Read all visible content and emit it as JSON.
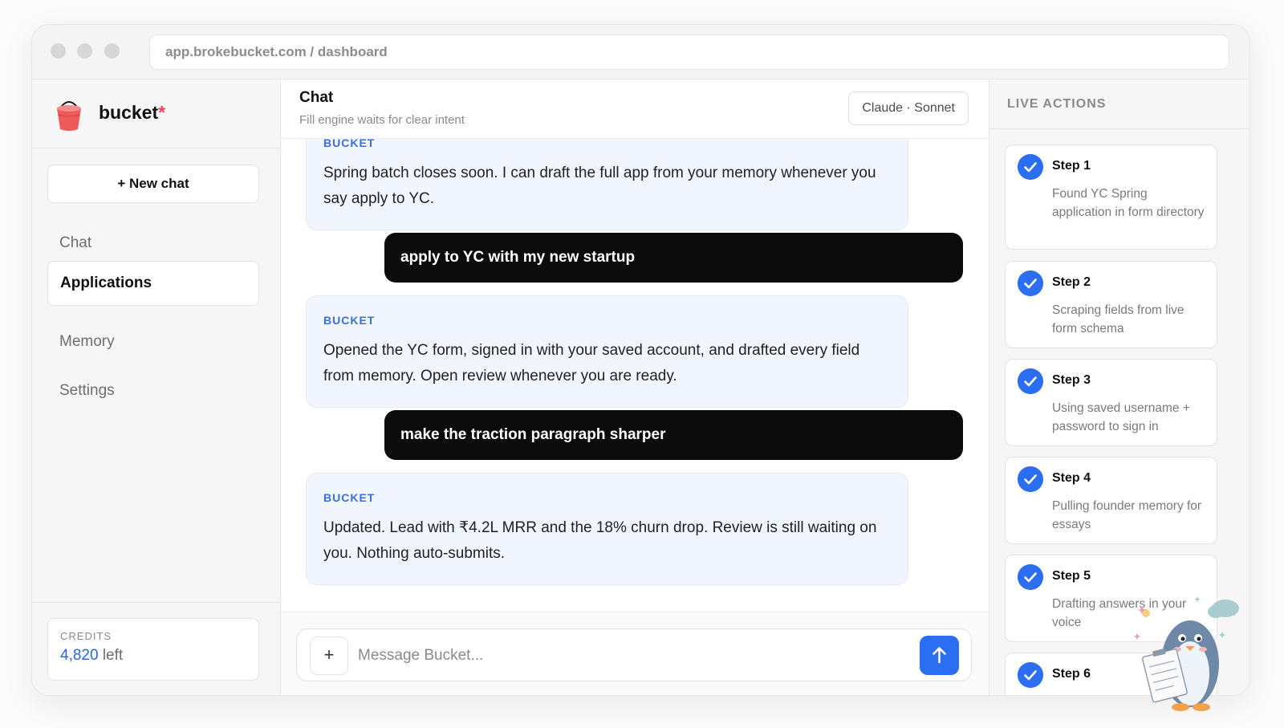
{
  "browser": {
    "url": "app.brokebucket.com / dashboard"
  },
  "brand": {
    "name": "bucket",
    "mark": "*"
  },
  "sidebar": {
    "new_chat_label": "+ New chat",
    "items": [
      {
        "label": "Chat",
        "active": false
      },
      {
        "label": "Applications",
        "active": true
      },
      {
        "label": "Memory",
        "active": false
      },
      {
        "label": "Settings",
        "active": false
      }
    ],
    "credits": {
      "label": "CREDITS",
      "value": "4,820",
      "suffix": "left"
    }
  },
  "chat": {
    "title": "Chat",
    "subtitle": "Fill engine waits for clear intent",
    "model": "Claude · Sonnet",
    "messages": [
      {
        "role": "bot",
        "label": "BUCKET",
        "text": "Spring batch closes soon. I can draft the full app from your memory whenever you say apply to YC."
      },
      {
        "role": "user",
        "text": "apply to YC with my new startup"
      },
      {
        "role": "bot",
        "label": "BUCKET",
        "text": "Opened the YC form, signed in with your saved account, and drafted every field from memory. Open review whenever you are ready."
      },
      {
        "role": "user",
        "text": "make the traction paragraph sharper"
      },
      {
        "role": "bot",
        "label": "BUCKET",
        "text": "Updated. Lead with ₹4.2L MRR and the 18% churn drop. Review is still waiting on you. Nothing auto-submits."
      }
    ],
    "composer": {
      "plus_label": "+",
      "placeholder": "Message Bucket..."
    }
  },
  "live_actions": {
    "title": "LIVE ACTIONS",
    "steps": [
      {
        "title": "Step 1",
        "desc": "Found YC Spring application in form directory",
        "done": true
      },
      {
        "title": "Step 2",
        "desc": "Scraping fields from live form schema",
        "done": true
      },
      {
        "title": "Step 3",
        "desc": "Using saved username + password to sign in",
        "done": true
      },
      {
        "title": "Step 4",
        "desc": "Pulling founder memory for essays",
        "done": true
      },
      {
        "title": "Step 5",
        "desc": "Drafting answers in your voice",
        "done": true
      },
      {
        "title": "Step 6",
        "desc": "",
        "done": true
      }
    ]
  },
  "colors": {
    "accent": "#2c6ef2",
    "brand_star": "#ef3f5f",
    "bot_label": "#3b6fe0",
    "user_bubble": "#0b0b0b"
  },
  "icons": {
    "logo": "bucket-logo-icon",
    "send": "arrow-up-icon",
    "check": "check-circle-icon",
    "mascot": "penguin-mascot-icon"
  }
}
